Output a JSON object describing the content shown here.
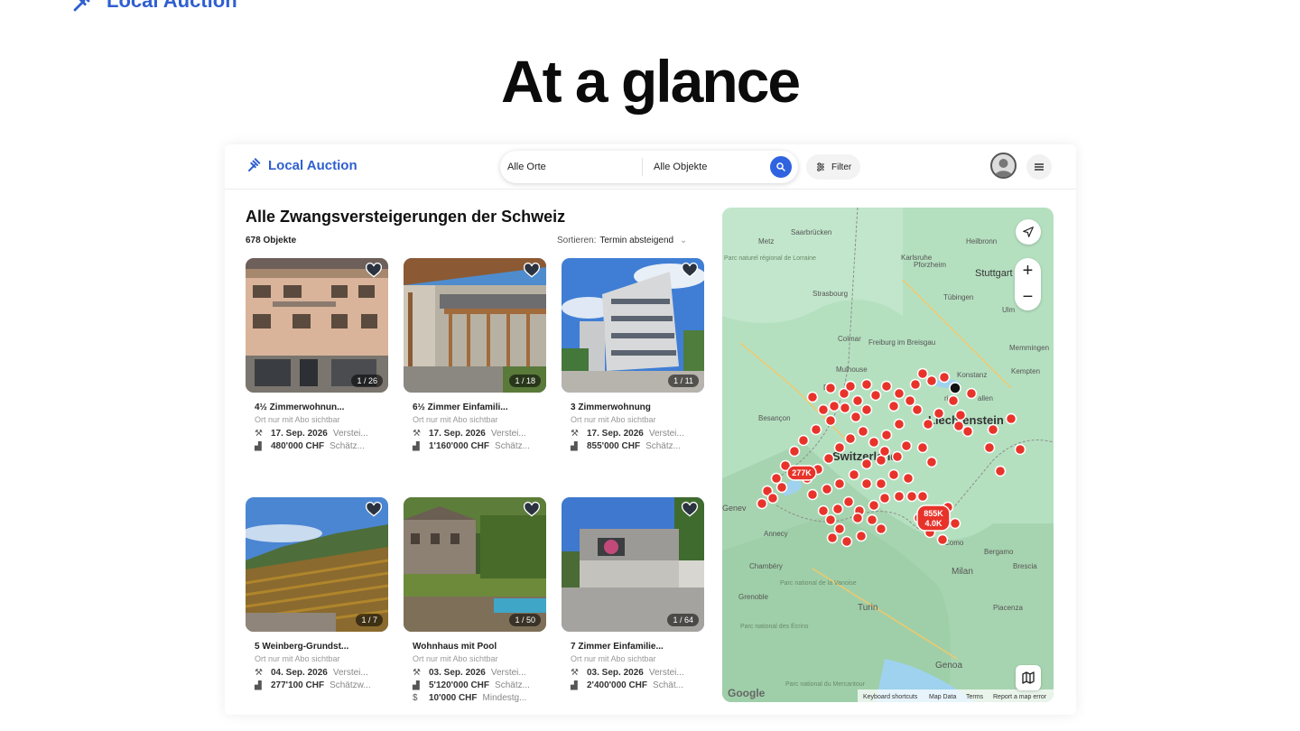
{
  "page": {
    "top_logo": "Local Auction",
    "hero_title": "At a glance"
  },
  "app": {
    "brand": "Local Auction",
    "search": {
      "location": "Alle Orte",
      "object": "Alle Objekte"
    },
    "filter_label": "Filter",
    "list": {
      "title": "Alle Zwangsversteigerungen der Schweiz",
      "count": "678 Objekte",
      "sort_label": "Sortieren:",
      "sort_value": "Termin absteigend"
    },
    "cards": [
      {
        "title": "4½ Zimmerwohnun...",
        "sub": "Ort nur mit Abo sichtbar",
        "date": "17. Sep. 2026",
        "date_lbl": "Verstei...",
        "price": "480'000 CHF",
        "price_lbl": "Schätz...",
        "counter": "1 / 26"
      },
      {
        "title": "6½ Zimmer Einfamili...",
        "sub": "Ort nur mit Abo sichtbar",
        "date": "17. Sep. 2026",
        "date_lbl": "Verstei...",
        "price": "1'160'000 CHF",
        "price_lbl": "Schätz...",
        "counter": "1 / 18"
      },
      {
        "title": "3 Zimmerwohnung",
        "sub": "Ort nur mit Abo sichtbar",
        "date": "17. Sep. 2026",
        "date_lbl": "Verstei...",
        "price": "855'000 CHF",
        "price_lbl": "Schätz...",
        "counter": "1 / 11"
      },
      {
        "title": "5 Weinberg-Grundst...",
        "sub": "Ort nur mit Abo sichtbar",
        "date": "04. Sep. 2026",
        "date_lbl": "Verstei...",
        "price": "277'100 CHF",
        "price_lbl": "Schätzw...",
        "counter": "1 / 7"
      },
      {
        "title": "Wohnhaus mit Pool",
        "sub": "Ort nur mit Abo sichtbar",
        "date": "03. Sep. 2026",
        "date_lbl": "Verstei...",
        "price": "5'120'000 CHF",
        "price_lbl": "Schätz...",
        "extra": "10'000 CHF",
        "extra_lbl": "Mindestg...",
        "counter": "1 / 50"
      },
      {
        "title": "7 Zimmer Einfamilie...",
        "sub": "Ort nur mit Abo sichtbar",
        "date": "03. Sep. 2026",
        "date_lbl": "Verstei...",
        "price": "2'400'000 CHF",
        "price_lbl": "Schät...",
        "counter": "1 / 64"
      }
    ],
    "map": {
      "labels": {
        "metz": "Metz",
        "saarbrucken": "Saarbrücken",
        "heilbronn": "Heilbronn",
        "karlsruhe": "Karlsruhe",
        "pforzheim": "Pforzheim",
        "stuttgart": "Stuttgart",
        "parc_lorraine": "Parc naturel régional de Lorraine",
        "strasbourg": "Strasbourg",
        "tubingen": "Tübingen",
        "ulm": "Ulm",
        "colmar": "Colmar",
        "freiburg": "Freiburg im Breisgau",
        "mulhouse": "Mulhouse",
        "memmingen": "Memmingen",
        "kempten": "Kempten",
        "konstanz": "Konstanz",
        "basel": "Bas",
        "zurich": "rich",
        "gallen": "allen",
        "besancon": "Besançon",
        "liechtenstein": "Liechtenstein",
        "switzerland": "Switzerland",
        "geneva": "Genev",
        "annecy": "Annecy",
        "chambery": "Chambéry",
        "grenoble": "Grenoble",
        "parc_vanoise": "Parc national de la Vanoise",
        "parc_ecrins": "Parc national des Écrins",
        "parc_mercantour": "Parc national du Mercantour",
        "turin": "Turin",
        "milan": "Milan",
        "como": "Como",
        "bergamo": "Bergamo",
        "brescia": "Brescia",
        "piacenza": "Piacenza",
        "genoa": "Genoa"
      },
      "cluster_labels": [
        "277K",
        "855K",
        "4.0K"
      ],
      "footer": {
        "google": "Google",
        "shortcuts": "Keyboard shortcuts",
        "mapdata": "Map Data",
        "terms": "Terms",
        "report": "Report a map error"
      },
      "colors": {
        "land": "#b9e2c4",
        "water": "#a8d6f0",
        "pin": "#e8332a"
      }
    }
  }
}
